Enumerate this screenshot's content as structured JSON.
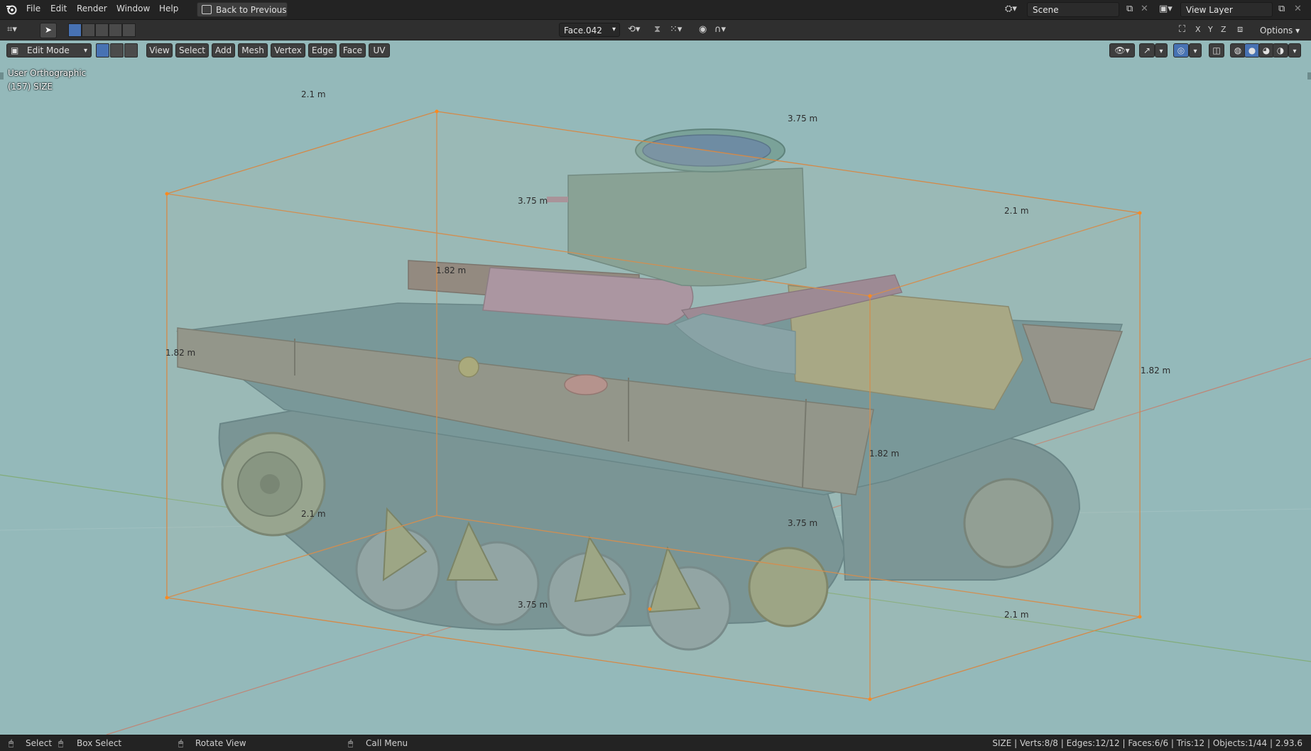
{
  "menubar": {
    "logo_icon": "blender-logo-icon",
    "items": [
      "File",
      "Edit",
      "Render",
      "Window",
      "Help"
    ],
    "back_button": "Back to Previous",
    "scene_label": "Scene",
    "view_layer_label": "View Layer"
  },
  "toolrow": {
    "active_face": "Face.042",
    "axes": [
      "X",
      "Y",
      "Z"
    ],
    "options_label": "Options"
  },
  "viewport_header": {
    "mode": "Edit Mode",
    "menus": [
      "View",
      "Select",
      "Add",
      "Mesh",
      "Vertex",
      "Edge",
      "Face",
      "UV"
    ]
  },
  "viewport_overlay": {
    "projection": "User Orthographic",
    "object_info": "(157) SIZE"
  },
  "dimension_labels": [
    "2.1 m",
    "3.75 m",
    "3.75 m",
    "2.1 m",
    "1.82 m",
    "1.82 m",
    "1.82 m",
    "1.82 m",
    "2.1 m",
    "3.75 m",
    "3.75 m",
    "2.1 m"
  ],
  "statusbar": {
    "select": "Select",
    "box_select": "Box Select",
    "rotate_view": "Rotate View",
    "call_menu": "Call Menu",
    "stats": "SIZE | Verts:8/8 | Edges:12/12 | Faces:6/6 | Tris:12 | Objects:1/44 | 2.93.6"
  },
  "colors": {
    "viewport_bg": "#94b9ba",
    "bounding_box": "#d8843e",
    "header_bg": "#2f2f2f"
  }
}
